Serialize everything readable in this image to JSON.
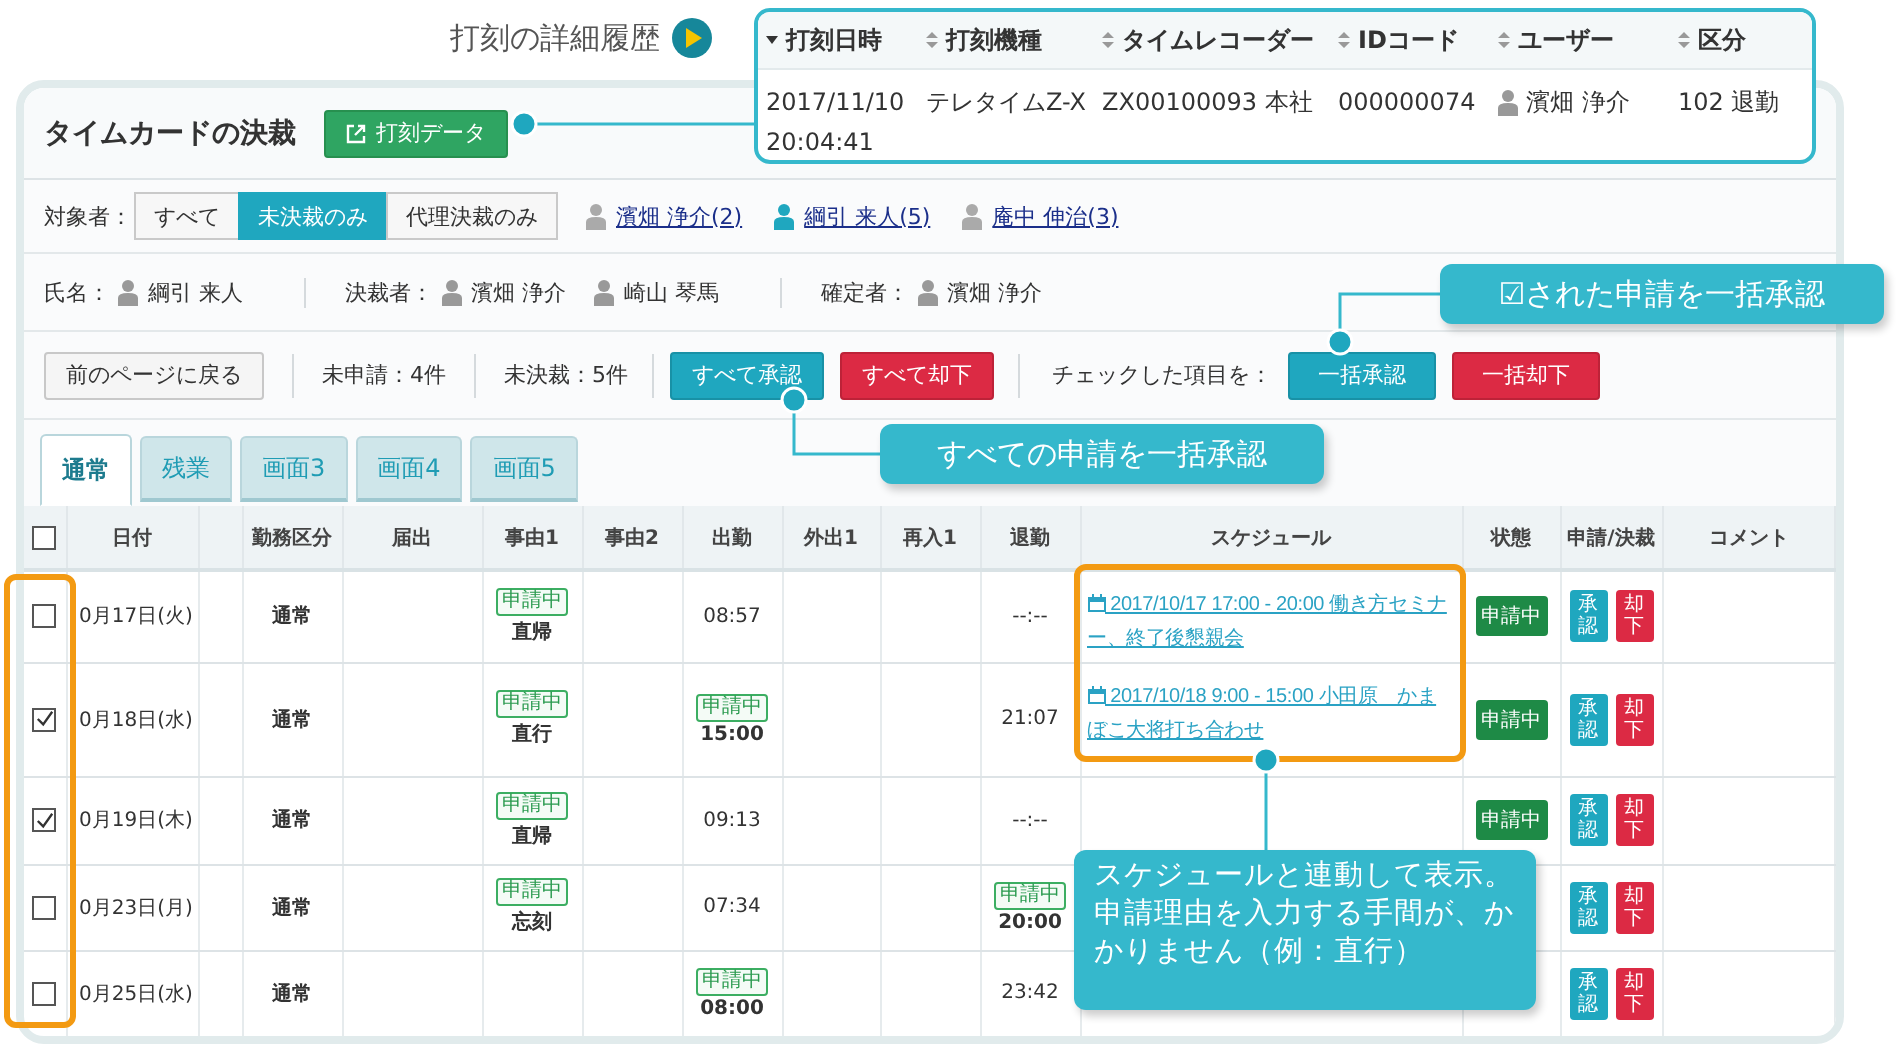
{
  "history": {
    "label": "打刻の詳細履歴",
    "columns": [
      {
        "label": "打刻日時",
        "sorted": true
      },
      {
        "label": "打刻機種",
        "sorted": false
      },
      {
        "label": "タイムレコーダー",
        "sorted": false
      },
      {
        "label": "IDコード",
        "sorted": false
      },
      {
        "label": "ユーザー",
        "sorted": false
      },
      {
        "label": "区分",
        "sorted": false
      }
    ],
    "row": [
      {
        "kind": "text",
        "text": "2017/11/10 20:04:41"
      },
      {
        "kind": "text",
        "text": "テレタイムZ-X"
      },
      {
        "kind": "text",
        "text": "ZX00100093 本社"
      },
      {
        "kind": "text",
        "text": "000000074"
      },
      {
        "kind": "user",
        "text": "濱畑 浄介"
      },
      {
        "kind": "text",
        "text": "102 退勤"
      }
    ]
  },
  "title": "タイムカードの決裁",
  "export_button": "打刻データ",
  "filter": {
    "label": "対象者：",
    "options": [
      {
        "label": "すべて",
        "selected": false
      },
      {
        "label": "未決裁のみ",
        "selected": true
      },
      {
        "label": "代理決裁のみ",
        "selected": false
      }
    ],
    "people": [
      {
        "name": "濱畑 浄介(2)",
        "selected": false
      },
      {
        "name": "綱引 来人(5)",
        "selected": true
      },
      {
        "name": "庵中 伸治(3)",
        "selected": false
      }
    ]
  },
  "people_row": [
    {
      "label": "氏名：",
      "people": [
        "綱引 来人"
      ]
    },
    {
      "label": "決裁者：",
      "people": [
        "濱畑 浄介",
        "崎山 琴馬"
      ]
    },
    {
      "label": "確定者：",
      "people": [
        "濱畑 浄介"
      ]
    }
  ],
  "actions": {
    "back": "前のページに戻る",
    "counts": [
      "未申請：4件",
      "未決裁：5件"
    ],
    "approve_all": "すべて承認",
    "reject_all": "すべて却下",
    "checked_label": "チェックした項目を：",
    "approve_checked": "一括承認",
    "reject_checked": "一括却下"
  },
  "tabs": [
    {
      "label": "通常",
      "selected": true
    },
    {
      "label": "残業",
      "selected": false
    },
    {
      "label": "画面3",
      "selected": false
    },
    {
      "label": "画面4",
      "selected": false
    },
    {
      "label": "画面5",
      "selected": false
    }
  ],
  "table": {
    "all_checked": false,
    "columns": [
      "日付",
      "勤務区分",
      "届出",
      "事由1",
      "事由2",
      "出勤",
      "外出1",
      "再入1",
      "退勤",
      "スケジュール",
      "状態",
      "申請/決裁",
      "コメント"
    ],
    "rows": [
      {
        "checked": false,
        "date": "0月17日(火)",
        "work_type": "通常",
        "reason1": {
          "badge": "申請中",
          "text": "直帰"
        },
        "clock_in": {
          "text": "08:57"
        },
        "clock_out": {
          "text": "--:--"
        },
        "schedule": "2017/10/17 17:00 - 20:00 働き方セミナー、終了後懇親会",
        "status": "申請中",
        "approve": "承認",
        "reject": "却下"
      },
      {
        "checked": true,
        "date": "0月18日(水)",
        "work_type": "通常",
        "reason1": {
          "badge": "申請中",
          "text": "直行"
        },
        "clock_in": {
          "badge": "申請中",
          "text": "15:00"
        },
        "clock_out": {
          "text": "21:07"
        },
        "schedule": "2017/10/18 9:00 - 15:00 小田原　かまぼこ大将打ち合わせ",
        "status": "申請中",
        "approve": "承認",
        "reject": "却下"
      },
      {
        "checked": true,
        "date": "0月19日(木)",
        "work_type": "通常",
        "reason1": {
          "badge": "申請中",
          "text": "直帰"
        },
        "clock_in": {
          "text": "09:13"
        },
        "clock_out": {
          "text": "--:--"
        },
        "status": "申請中",
        "approve": "承認",
        "reject": "却下"
      },
      {
        "checked": false,
        "date": "0月23日(月)",
        "work_type": "通常",
        "reason1": {
          "badge": "申請中",
          "text": "忘刻"
        },
        "clock_in": {
          "text": "07:34"
        },
        "clock_out": {
          "badge": "申請中",
          "text": "20:00"
        },
        "approve": "承認",
        "reject": "却下"
      },
      {
        "checked": false,
        "date": "0月25日(水)",
        "work_type": "通常",
        "clock_in": {
          "badge": "申請中",
          "text": "08:00"
        },
        "clock_out": {
          "text": "23:42"
        },
        "approve": "承認",
        "reject": "却下"
      }
    ]
  },
  "notes": [
    "☑された申請を一括承認",
    "すべての申請を一括承認",
    "スケジュールと連動して表示。申請理由を入力する手間が、かかりません（例：直行）"
  ]
}
